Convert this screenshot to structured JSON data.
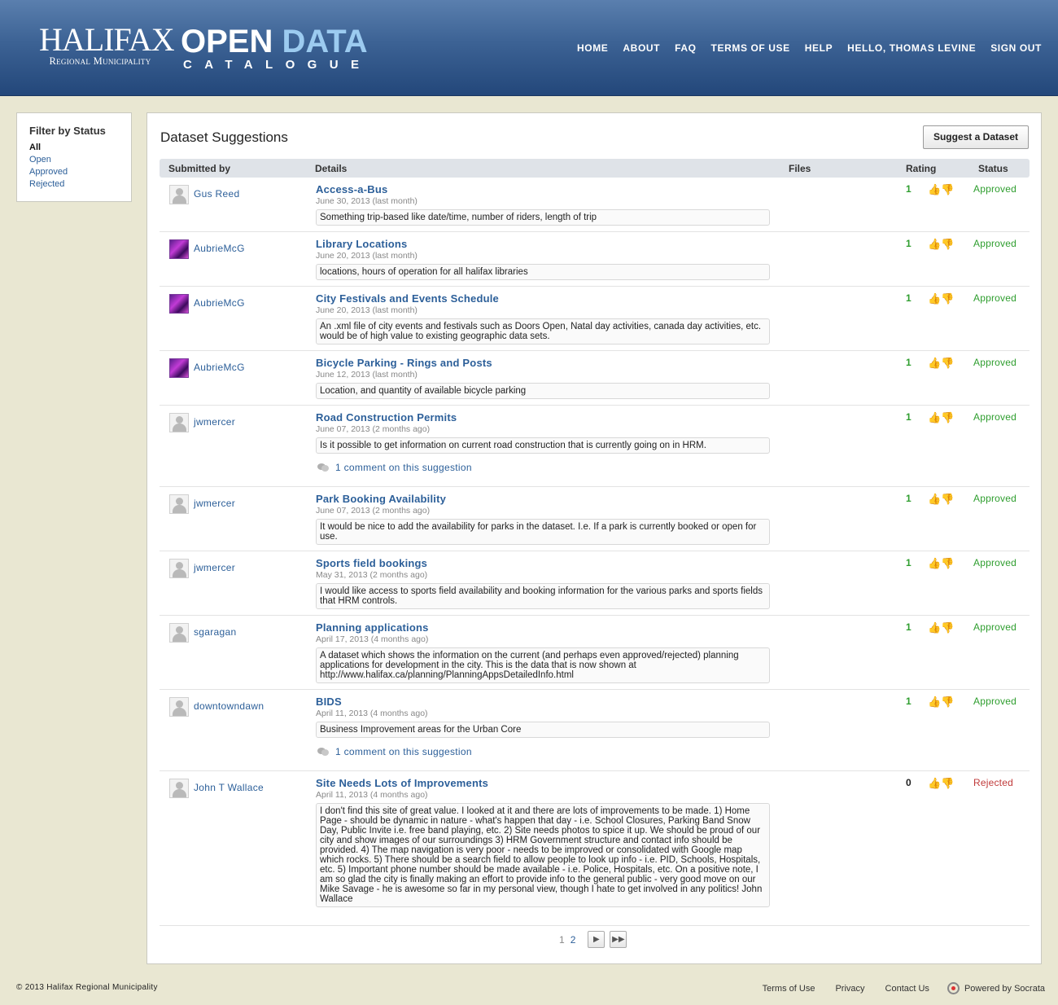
{
  "header": {
    "logo_main": "HALIFAX",
    "logo_sub": "Regional Municipality",
    "brand_open": "OPEN",
    "brand_data": "DATA",
    "brand_catalogue": "CATALOGUE",
    "nav": [
      "HOME",
      "ABOUT",
      "FAQ",
      "TERMS OF USE",
      "HELP",
      "HELLO, THOMAS LEVINE",
      "SIGN OUT"
    ]
  },
  "sidebar": {
    "title": "Filter by Status",
    "filters": [
      "All",
      "Open",
      "Approved",
      "Rejected"
    ],
    "active": "All"
  },
  "main": {
    "title": "Dataset Suggestions",
    "suggest_button": "Suggest a Dataset",
    "columns": [
      "Submitted by",
      "Details",
      "Files",
      "Rating",
      "Status"
    ],
    "rows": [
      {
        "user": "Gus Reed",
        "avatar": "default",
        "title": "Access-a-Bus",
        "date": "June 30, 2013 (last month)",
        "description": "Something trip-based like date/time, number of riders, length of trip",
        "comment": "",
        "score": "1",
        "status": "Approved"
      },
      {
        "user": "AubrieMcG",
        "avatar": "photo",
        "title": "Library Locations",
        "date": "June 20, 2013 (last month)",
        "description": "locations, hours of operation for all halifax libraries",
        "comment": "",
        "score": "1",
        "status": "Approved"
      },
      {
        "user": "AubrieMcG",
        "avatar": "photo",
        "title": "City Festivals and Events Schedule",
        "date": "June 20, 2013 (last month)",
        "description": "An .xml file of city events and festivals such as Doors Open, Natal day activities, canada day activities, etc. would be of high value to existing geographic data sets.",
        "comment": "",
        "score": "1",
        "status": "Approved"
      },
      {
        "user": "AubrieMcG",
        "avatar": "photo",
        "title": "Bicycle Parking - Rings and Posts",
        "date": "June 12, 2013 (last month)",
        "description": "Location, and quantity of available bicycle parking",
        "comment": "",
        "score": "1",
        "status": "Approved"
      },
      {
        "user": "jwmercer",
        "avatar": "default",
        "title": "Road Construction Permits",
        "date": "June 07, 2013 (2 months ago)",
        "description": "Is it possible to get information on current road construction that is currently going on in HRM.",
        "comment": "1 comment on this suggestion",
        "score": "1",
        "status": "Approved"
      },
      {
        "user": "jwmercer",
        "avatar": "default",
        "title": "Park Booking Availability",
        "date": "June 07, 2013 (2 months ago)",
        "description": "It would be nice to add the availability for parks in the dataset. I.e. If a park is currently booked or open for use.",
        "comment": "",
        "score": "1",
        "status": "Approved"
      },
      {
        "user": "jwmercer",
        "avatar": "default",
        "title": "Sports field bookings",
        "date": "May 31, 2013 (2 months ago)",
        "description": "I would like access to sports field availability and booking information for the various parks and sports fields that HRM controls.",
        "comment": "",
        "score": "1",
        "status": "Approved"
      },
      {
        "user": "sgaragan",
        "avatar": "default",
        "title": "Planning applications",
        "date": "April 17, 2013 (4 months ago)",
        "description": "A dataset which shows the information on the current (and perhaps even approved/rejected) planning applications for development in the city. This is the data that is now shown at http://www.halifax.ca/planning/PlanningAppsDetailedInfo.html",
        "comment": "",
        "score": "1",
        "status": "Approved"
      },
      {
        "user": "downtowndawn",
        "avatar": "default",
        "title": "BIDS",
        "date": "April 11, 2013 (4 months ago)",
        "description": "Business Improvement areas for the Urban Core",
        "comment": "1 comment on this suggestion",
        "score": "1",
        "status": "Approved"
      },
      {
        "user": "John T Wallace",
        "avatar": "default",
        "title": "Site Needs Lots of Improvements",
        "date": "April 11, 2013 (4 months ago)",
        "description": "I don't find this site of great value. I looked at it and there are lots of improvements to be made. 1) Home Page - should be dynamic in nature - what's happen that day - i.e. School Closures, Parking Band Snow Day, Public Invite i.e. free band playing, etc. 2) Site needs photos to spice it up. We should be proud of our city and show images of our surroundings 3) HRM Government structure and contact info should be provided. 4) The map navigation is very poor - needs to be improved or consolidated with Google map which rocks. 5) There should be a search field to allow people to look up info - i.e. PID, Schools, Hospitals, etc. 5) Important phone number should be made available - i.e. Police, Hospitals, etc. On a positive note, I am so glad the city is finally making an effort to provide info to the general public - very good move on our Mike Savage - he is awesome so far in my personal view, though I hate to get involved in any politics! John Wallace",
        "comment": "",
        "score": "0",
        "status": "Rejected"
      }
    ],
    "pagination": {
      "current": "1",
      "pages": [
        "2"
      ]
    }
  },
  "footer": {
    "copyright": "© 2013 Halifax Regional Municipality",
    "links": [
      "Terms of Use",
      "Privacy",
      "Contact Us"
    ],
    "powered_by": "Powered by Socrata"
  },
  "colors": {
    "approved": "#2f9e2f",
    "rejected": "#c03a3a",
    "link": "#2c5f99",
    "header": "#3c6294"
  }
}
